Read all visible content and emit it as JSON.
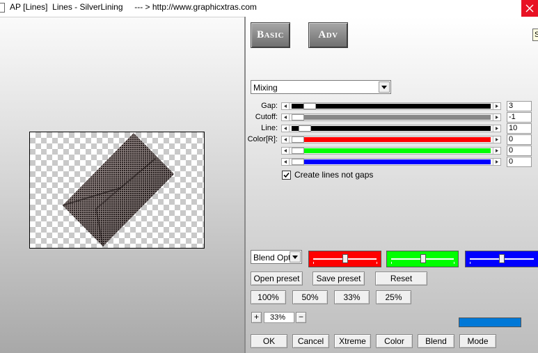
{
  "window": {
    "title": "AP [Lines]  Lines - SilverLining     --- > http://www.graphicxtras.com",
    "icons": [
      "app-icon",
      "close-icon"
    ]
  },
  "tabs": [
    {
      "label": "Basic"
    },
    {
      "label": "Adv"
    }
  ],
  "tooltip_char": "S",
  "mode_select": {
    "value": "Mixing"
  },
  "sliders": {
    "gap": {
      "label": "Gap:",
      "value": "3",
      "fill": "#000000"
    },
    "cutoff": {
      "label": "Cutoff:",
      "value": "-1",
      "fill": "#888888"
    },
    "line": {
      "label": "Line:",
      "value": "10",
      "fill": "#000000"
    },
    "color_r": {
      "label": "Color[R]:",
      "value": "0",
      "fill": "#ff0000"
    },
    "color_g": {
      "label": "",
      "value": "0",
      "fill": "#00ff00"
    },
    "color_b": {
      "label": "",
      "value": "0",
      "fill": "#0000ff"
    }
  },
  "checkbox": {
    "label": "Create lines not gaps",
    "checked": true
  },
  "blend_select": {
    "value": "Blend Opti"
  },
  "color_sliders": [
    {
      "color": "#ff0000"
    },
    {
      "color": "#00ff00"
    },
    {
      "color": "#0000ff"
    }
  ],
  "preset_buttons": {
    "open": "Open preset",
    "save": "Save preset",
    "reset": "Reset"
  },
  "zoom_buttons": [
    "100%",
    "50%",
    "33%",
    "25%"
  ],
  "zoom": {
    "plus": "+",
    "value": "33%",
    "minus": "−"
  },
  "swatch_color": "#0078d7",
  "bottom_buttons": [
    "OK",
    "Cancel",
    "Xtreme",
    "Color",
    "Blend",
    "Mode"
  ]
}
